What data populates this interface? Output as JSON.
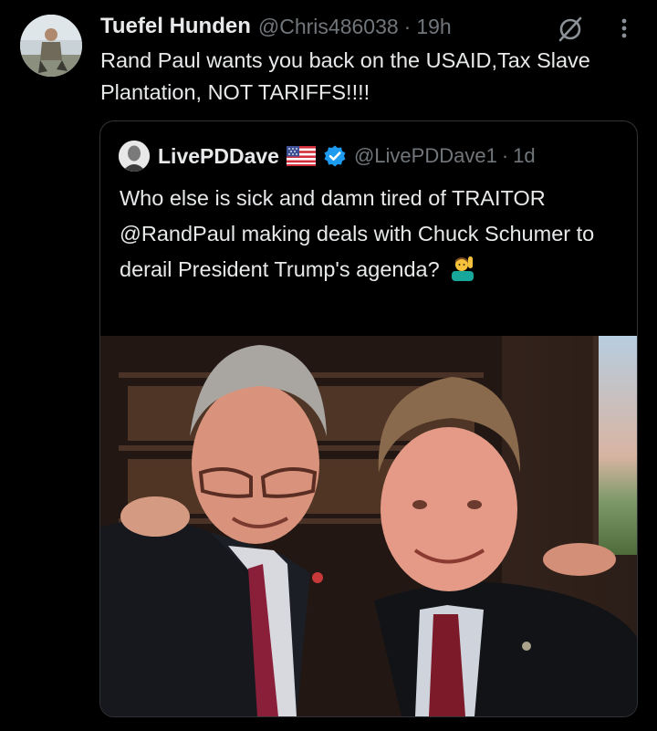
{
  "post": {
    "author_name": "Tuefel Hunden",
    "author_handle": "@Chris486038",
    "separator": "·",
    "time": "19h",
    "text": "Rand Paul wants you back on the USAID,Tax Slave Plantation, NOT TARIFFS!!!!",
    "icons": {
      "grok": "grok-icon",
      "more": "more-icon"
    }
  },
  "quote": {
    "author_name": "LivePDDave",
    "author_handle": "@LivePDDave1",
    "separator": "·",
    "time": "1d",
    "text": "Who else is sick and damn tired of TRAITOR @RandPaul making deals with Chuck Schumer to derail President Trump's agenda?",
    "icons": {
      "flag": "us-flag-icon",
      "verified": "verified-badge-icon",
      "emoji": "man-raising-hand-emoji"
    }
  },
  "colors": {
    "background": "#000000",
    "text_primary": "#e7e9ea",
    "text_secondary": "#71767b",
    "border": "#2f3336",
    "verified_blue": "#1d9bf0"
  }
}
